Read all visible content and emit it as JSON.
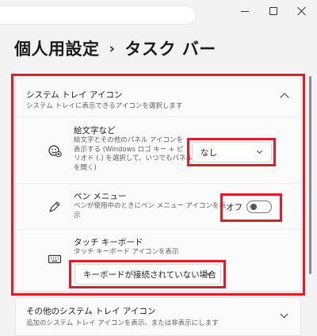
{
  "window": {
    "controls": [
      "minimize",
      "maximize",
      "close"
    ]
  },
  "header": {
    "title": "個人用設定",
    "separator": "›",
    "subtitle": "タスク バー"
  },
  "system_tray": {
    "title": "システム トレイ アイコン",
    "description": "システム トレイに表示できるアイコンを選択します",
    "items": [
      {
        "title": "絵文字など",
        "description": [
          "絵文字とその他のパネル アイコンを",
          "表示する (Windows ロゴ キー + ピ",
          "リオド (.) を選択して、いつでもパネル",
          "を開く)"
        ],
        "control": "dropdown",
        "value": "なし",
        "icon": "emoji-panel-icon"
      },
      {
        "title": "ペン メニュー",
        "description": [
          "ペンが使用中のときにペン メニュー アイコンを表",
          "示"
        ],
        "control": "toggle",
        "value": "オフ",
        "state": false,
        "icon": "pen-icon"
      },
      {
        "title": "タッチ キーボード",
        "description": [
          "タッチ キーボード アイコンを表示"
        ],
        "control": "dropdown",
        "value": "キーボードが接続されていない場合",
        "icon": "keyboard-icon"
      }
    ]
  },
  "other_tray": {
    "title": "その他のシステム トレイ アイコン",
    "description": "追加のシステム トレイ アイコンを表示、または非表示にします"
  },
  "highlight_color": "#e01e2a"
}
